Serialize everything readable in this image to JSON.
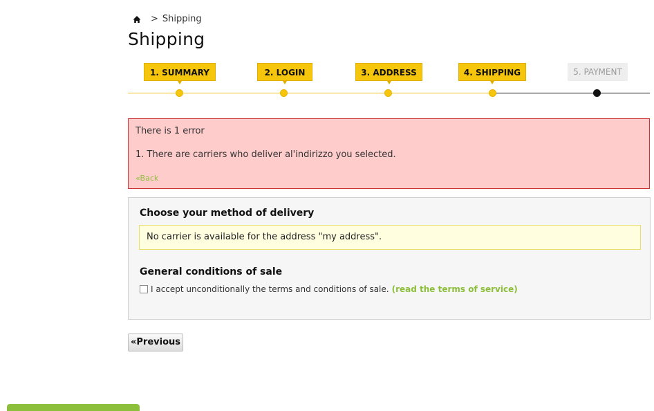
{
  "breadcrumb": {
    "home_icon": "home-icon",
    "separator": ">",
    "current": "Shipping"
  },
  "page_title": "Shipping",
  "steps": [
    {
      "label": "1. SUMMARY",
      "state": "done"
    },
    {
      "label": "2. LOGIN",
      "state": "done"
    },
    {
      "label": "3. ADDRESS",
      "state": "done"
    },
    {
      "label": "4. SHIPPING",
      "state": "done"
    },
    {
      "label": "5. PAYMENT",
      "state": "todo"
    }
  ],
  "error": {
    "title": "There is 1 error",
    "items": [
      "1.  There are carriers who deliver al'indirizzo you selected."
    ],
    "back_link": "«Back"
  },
  "delivery": {
    "heading": "Choose your method of delivery",
    "warning": "No carrier is available for the address \"my address\".",
    "conditions_heading": "General conditions of sale",
    "terms_text": "I accept unconditionally the terms and conditions of sale.",
    "terms_link": "(read the terms of service)",
    "terms_checked": false
  },
  "previous_button": "«Previous",
  "colors": {
    "accent": "#f6c60c",
    "link": "#8cbf3b",
    "error_bg": "#ffcccc",
    "error_border": "#cc3333"
  }
}
